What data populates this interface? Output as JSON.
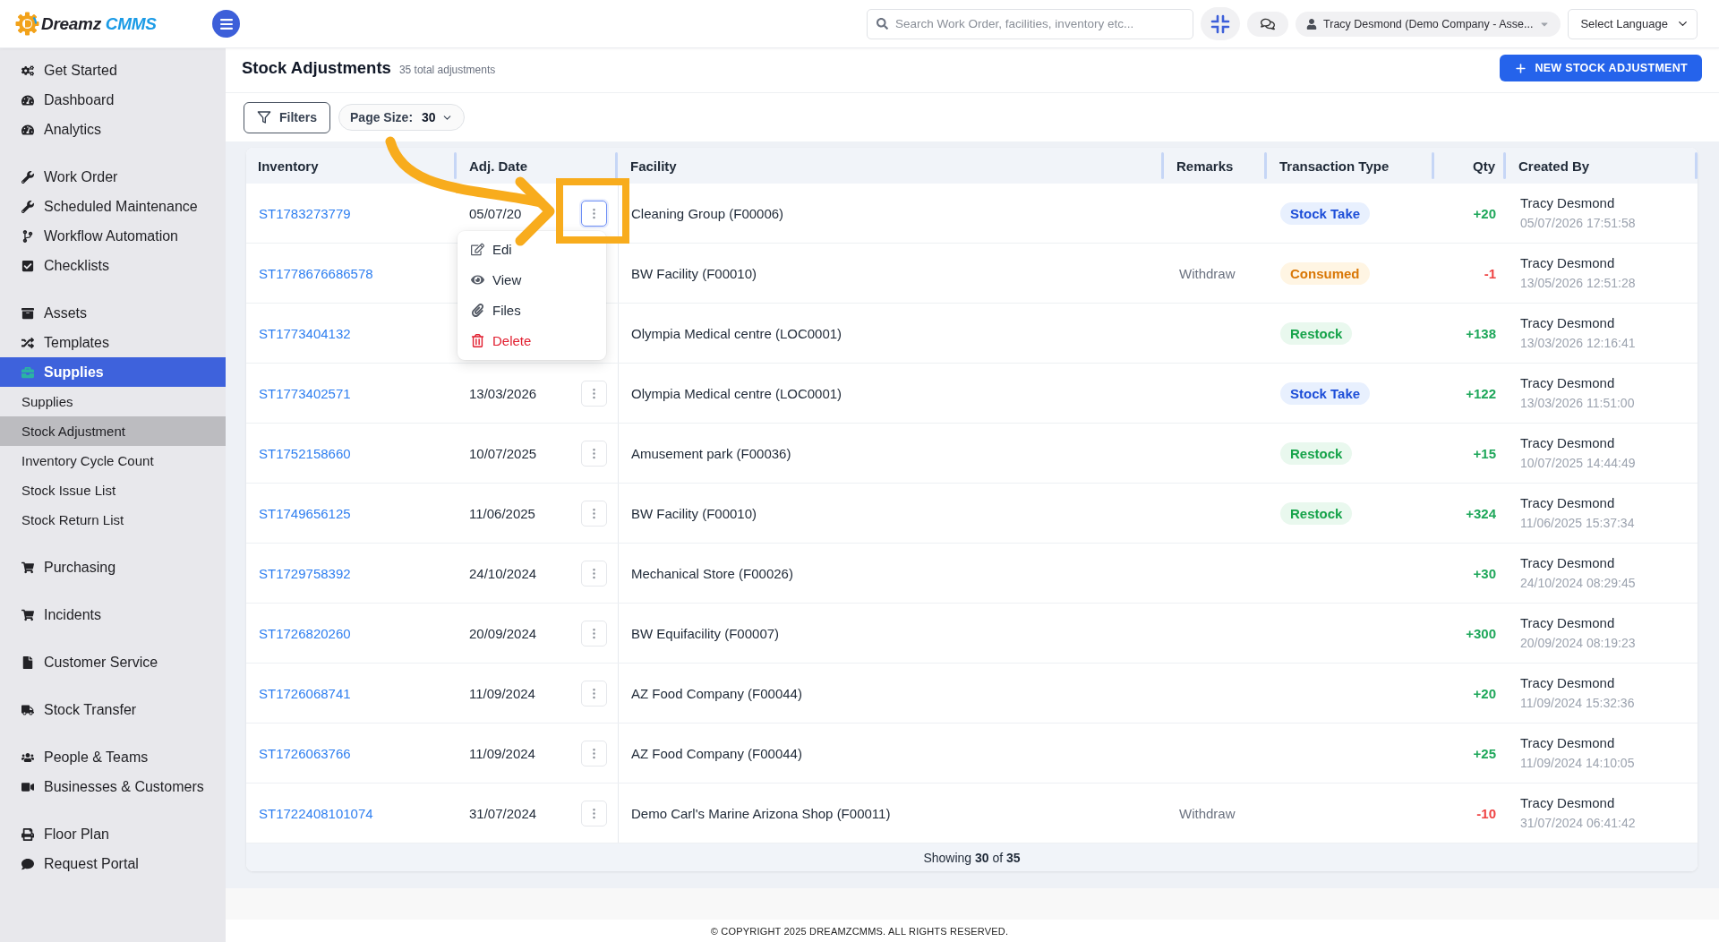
{
  "header": {
    "logo": {
      "name": "Dreamz",
      "suffix": "CMMS"
    },
    "search": {
      "placeholder": "Search Work Order, facilities, inventory etc..."
    },
    "user": "Tracy Desmond (Demo Company - Asse...",
    "language": "Select Language"
  },
  "sidebar": {
    "groups": [
      {
        "items": [
          {
            "label": "Get Started",
            "selected": false
          },
          {
            "label": "Dashboard",
            "selected": false
          },
          {
            "label": "Analytics",
            "selected": false
          }
        ]
      },
      {
        "items": [
          {
            "label": "Work Order",
            "selected": false
          },
          {
            "label": "Scheduled Maintenance",
            "selected": false
          },
          {
            "label": "Workflow Automation",
            "selected": false
          },
          {
            "label": "Checklists",
            "selected": false
          }
        ]
      },
      {
        "items": [
          {
            "label": "Assets",
            "selected": false
          },
          {
            "label": "Templates",
            "selected": false
          },
          {
            "label": "Supplies",
            "selected": true,
            "children": [
              {
                "label": "Supplies",
                "selected": false
              },
              {
                "label": "Stock Adjustment",
                "selected": true
              },
              {
                "label": "Inventory Cycle Count",
                "selected": false
              },
              {
                "label": "Stock Issue List",
                "selected": false
              },
              {
                "label": "Stock Return List",
                "selected": false
              }
            ]
          }
        ]
      },
      {
        "items": [
          {
            "label": "Purchasing",
            "selected": false
          }
        ]
      },
      {
        "items": [
          {
            "label": "Incidents",
            "selected": false
          }
        ]
      },
      {
        "items": [
          {
            "label": "Customer Service",
            "selected": false
          }
        ]
      },
      {
        "items": [
          {
            "label": "Stock Transfer",
            "selected": false
          }
        ]
      },
      {
        "items": [
          {
            "label": "People & Teams",
            "selected": false
          },
          {
            "label": "Businesses & Customers",
            "selected": false
          }
        ]
      },
      {
        "items": [
          {
            "label": "Floor Plan",
            "selected": false
          },
          {
            "label": "Request Portal",
            "selected": false
          }
        ]
      }
    ]
  },
  "page": {
    "title": "Stock Adjustments",
    "count": "35 total adjustments",
    "new_button": "NEW STOCK ADJUSTMENT"
  },
  "toolbar": {
    "filters": "Filters",
    "page_size": {
      "label": "Page Size:",
      "value": "30"
    }
  },
  "table": {
    "columns": [
      "Inventory",
      "Adj. Date",
      "Facility",
      "Remarks",
      "Transaction Type",
      "Qty",
      "Created By"
    ],
    "rows": [
      {
        "inventory": "ST1783273779",
        "date": "05/07/20",
        "actions": {
          "open": true
        },
        "facility": "Cleaning Group (F00006)",
        "type": {
          "label": "Stock Take",
          "kind": "stock_take"
        },
        "qty": {
          "text": "+20",
          "kind": "increase"
        },
        "created_by": {
          "name": "Tracy Desmond",
          "time": "05/07/2026 17:51:58"
        }
      },
      {
        "inventory": "ST1778676686578",
        "facility": "BW Facility (F00010)",
        "remarks": "Withdraw",
        "type": {
          "label": "Consumed",
          "kind": "consumed"
        },
        "qty": {
          "text": "-1",
          "kind": "decrease"
        },
        "created_by": {
          "name": "Tracy Desmond",
          "time": "13/05/2026 12:51:28"
        }
      },
      {
        "inventory": "ST1773404132",
        "facility": "Olympia Medical centre (LOC0001)",
        "type": {
          "label": "Restock",
          "kind": "restock"
        },
        "qty": {
          "text": "+138",
          "kind": "increase"
        },
        "created_by": {
          "name": "Tracy Desmond",
          "time": "13/03/2026 12:16:41"
        }
      },
      {
        "inventory": "ST1773402571",
        "date": "13/03/2026",
        "actions": {
          "open": false
        },
        "facility": "Olympia Medical centre (LOC0001)",
        "type": {
          "label": "Stock Take",
          "kind": "stock_take"
        },
        "qty": {
          "text": "+122",
          "kind": "increase"
        },
        "created_by": {
          "name": "Tracy Desmond",
          "time": "13/03/2026 11:51:00"
        }
      },
      {
        "inventory": "ST1752158660",
        "date": "10/07/2025",
        "actions": {
          "open": false
        },
        "facility": "Amusement park (F00036)",
        "type": {
          "label": "Restock",
          "kind": "restock"
        },
        "qty": {
          "text": "+15",
          "kind": "increase"
        },
        "created_by": {
          "name": "Tracy Desmond",
          "time": "10/07/2025 14:44:49"
        }
      },
      {
        "inventory": "ST1749656125",
        "date": "11/06/2025",
        "actions": {
          "open": false
        },
        "facility": "BW Facility (F00010)",
        "type": {
          "label": "Restock",
          "kind": "restock"
        },
        "qty": {
          "text": "+324",
          "kind": "increase"
        },
        "created_by": {
          "name": "Tracy Desmond",
          "time": "11/06/2025 15:37:34"
        }
      },
      {
        "inventory": "ST1729758392",
        "date": "24/10/2024",
        "actions": {
          "open": false
        },
        "facility": "Mechanical Store (F00026)",
        "qty": {
          "text": "+30",
          "kind": "increase"
        },
        "created_by": {
          "name": "Tracy Desmond",
          "time": "24/10/2024 08:29:45"
        }
      },
      {
        "inventory": "ST1726820260",
        "date": "20/09/2024",
        "actions": {
          "open": false
        },
        "facility": "BW Equifacility (F00007)",
        "qty": {
          "text": "+300",
          "kind": "increase"
        },
        "created_by": {
          "name": "Tracy Desmond",
          "time": "20/09/2024 08:19:23"
        }
      },
      {
        "inventory": "ST1726068741",
        "date": "11/09/2024",
        "actions": {
          "open": false
        },
        "facility": "AZ Food Company (F00044)",
        "qty": {
          "text": "+20",
          "kind": "increase"
        },
        "created_by": {
          "name": "Tracy Desmond",
          "time": "11/09/2024 15:32:36"
        }
      },
      {
        "inventory": "ST1726063766",
        "date": "11/09/2024",
        "actions": {
          "open": false
        },
        "facility": "AZ Food Company (F00044)",
        "qty": {
          "text": "+25",
          "kind": "increase"
        },
        "created_by": {
          "name": "Tracy Desmond",
          "time": "11/09/2024 14:10:05"
        }
      },
      {
        "inventory": "ST1722408101074",
        "date": "31/07/2024",
        "actions": {
          "open": false
        },
        "facility": "Demo Carl's Marine Arizona Shop (F00011)",
        "remarks": "Withdraw",
        "qty": {
          "text": "-10",
          "kind": "decrease"
        },
        "created_by": {
          "name": "Tracy Desmond",
          "time": "31/07/2024 06:41:42"
        }
      }
    ],
    "action_menu": {
      "items": [
        {
          "label": "Edi",
          "kind": "edit"
        },
        {
          "label": "View",
          "kind": "view"
        },
        {
          "label": "Files",
          "kind": "files"
        },
        {
          "label": "Delete",
          "kind": "delete"
        }
      ]
    },
    "summary": "Showing **30** of **35**"
  },
  "annotation": {
    "kind": "arrow_and_frame"
  },
  "footer": {
    "copyright": "© COPYRIGHT 2025 DREAMZCMMS. ALL RIGHTS RESERVED."
  }
}
